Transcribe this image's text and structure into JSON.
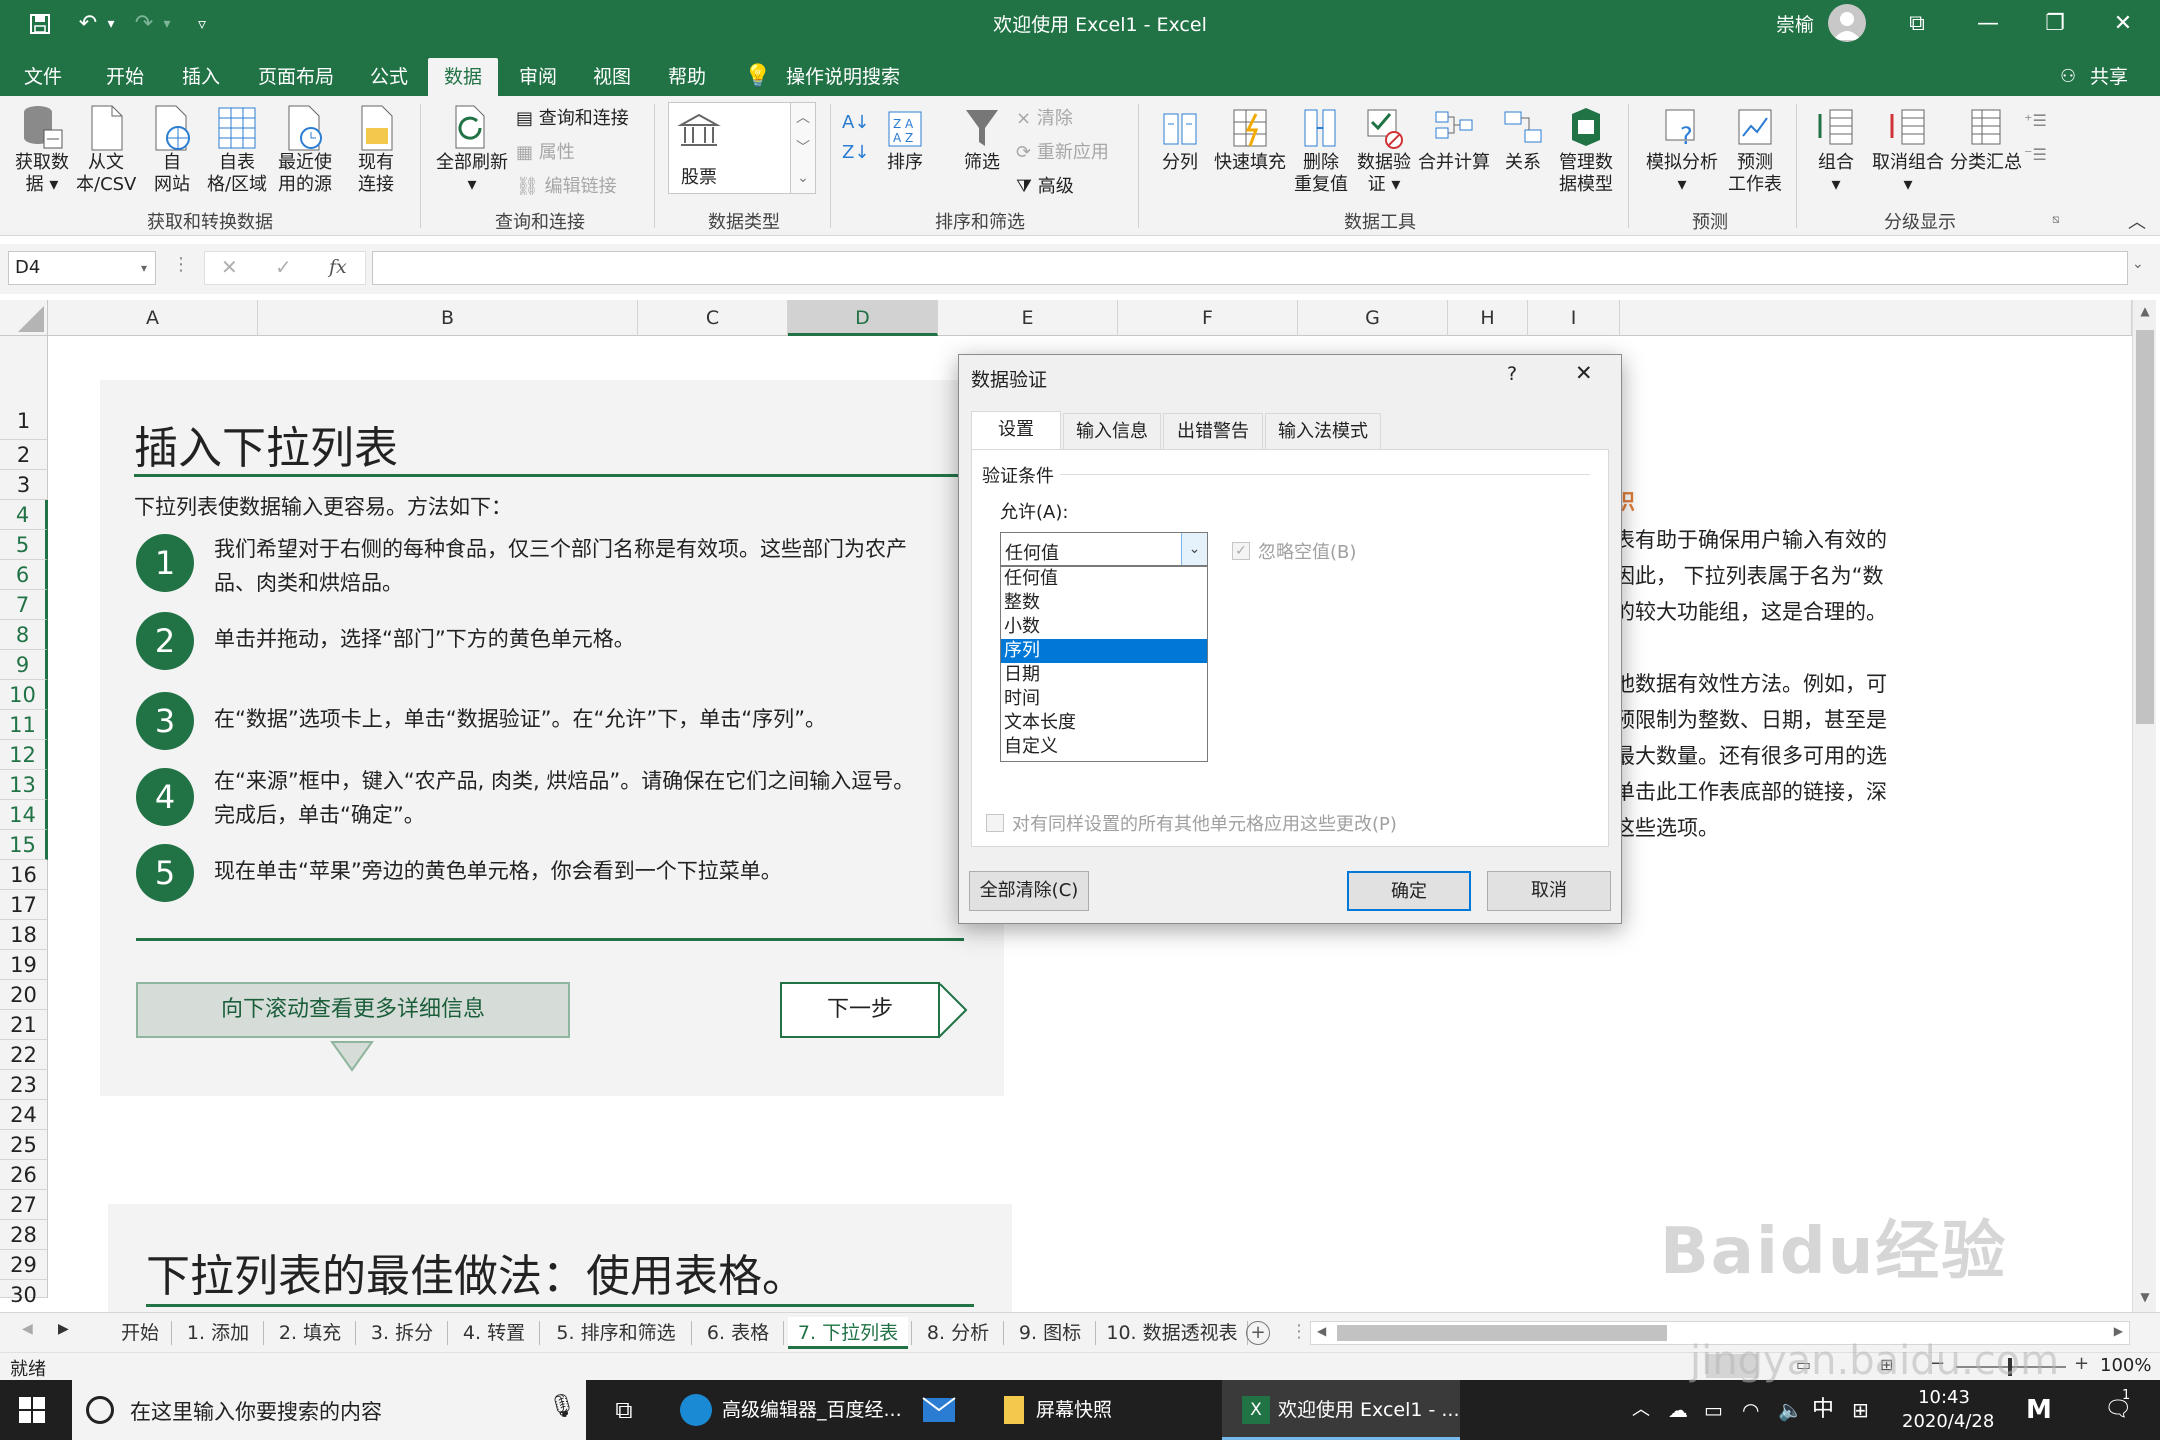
{
  "window": {
    "title": "欢迎使用 Excel1  -  Excel",
    "user": "崇榆"
  },
  "menu": {
    "items": [
      "文件",
      "开始",
      "插入",
      "页面布局",
      "公式",
      "数据",
      "审阅",
      "视图",
      "帮助"
    ],
    "search": "操作说明搜索",
    "share": "共享"
  },
  "ribbon": {
    "get_data": {
      "btn1": "获取数",
      "btn1b": "据",
      "btn2": "从文",
      "btn2b": "本/CSV",
      "btn3": "自",
      "btn3b": "网站",
      "btn4": "自表",
      "btn4b": "格/区域",
      "btn5": "最近使",
      "btn5b": "用的源",
      "btn6": "现有",
      "btn6b": "连接",
      "label": "获取和转换数据"
    },
    "query": {
      "refresh": "全部刷新",
      "qc": "查询和连接",
      "props": "属性",
      "links": "编辑链接",
      "label": "查询和连接"
    },
    "types": {
      "stock": "股票",
      "label": "数据类型"
    },
    "sort": {
      "sort": "排序",
      "filter": "筛选",
      "clear": "清除",
      "reapply": "重新应用",
      "advanced": "高级",
      "label": "排序和筛选"
    },
    "tools": {
      "split": "分列",
      "flash": "快速填充",
      "dedupe": "删除",
      "dedupe2": "重复值",
      "validate": "数据验",
      "validate2": "证",
      "consolidate": "合并计算",
      "relations": "关系",
      "model": "管理数",
      "model2": "据模型",
      "label": "数据工具"
    },
    "forecast": {
      "whatif": "模拟分析",
      "sheet": "预测",
      "sheet2": "工作表",
      "label": "预测"
    },
    "outline": {
      "group": "组合",
      "ungroup": "取消组合",
      "subtotal": "分类汇总",
      "label": "分级显示"
    }
  },
  "formula": {
    "namebox": "D4",
    "fx": "fx"
  },
  "columns": [
    "A",
    "B",
    "C",
    "D",
    "E",
    "F",
    "G",
    "H",
    "I"
  ],
  "rows": [
    "1",
    "2",
    "3",
    "4",
    "5",
    "6",
    "7",
    "8",
    "9",
    "10",
    "11",
    "12",
    "13",
    "14",
    "15",
    "16",
    "17",
    "18",
    "19",
    "20",
    "21",
    "22",
    "23",
    "24",
    "25",
    "26",
    "27",
    "28",
    "29",
    "30"
  ],
  "card1": {
    "title": "插入下拉列表",
    "intro": "下拉列表使数据输入更容易。方法如下：",
    "steps": [
      {
        "n": "1",
        "l1": "我们希望对于右侧的每种食品，仅三个部门名称是有效项。这些部门为农产",
        "l2": "品、肉类和烘焙品。"
      },
      {
        "n": "2",
        "l1": "单击并拖动，选择“部门”下方的黄色单元格。",
        "l2": ""
      },
      {
        "n": "3",
        "l1": "在“数据”选项卡上，单击“数据验证”。在“允许”下，单击“序列”。",
        "l2": ""
      },
      {
        "n": "4",
        "l1": "在“来源”框中，键入“农产品, 肉类, 烘焙品”。请确保在它们之间输入逗号。",
        "l2": "完成后，单击“确定”。"
      },
      {
        "n": "5",
        "l1": "现在单击“苹果”旁边的黄色单元格，你会看到一个下拉菜单。",
        "l2": ""
      }
    ],
    "scroll_btn": "向下滚动查看更多详细信息",
    "next_btn": "下一步"
  },
  "card2": {
    "title": "下拉列表的最佳做法：使用表格。"
  },
  "right_text": {
    "heading": "识",
    "lines": [
      "表有助于确保用户输入有效的",
      "因此， 下拉列表属于名为“数",
      "的较大功能组，这是合理的。",
      "",
      "他数据有效性方法。例如，可",
      "预限制为整数、日期，甚至是",
      "最大数量。还有很多可用的选",
      "单击此工作表底部的链接，深",
      "这些选项。"
    ]
  },
  "dialog": {
    "title": "数据验证",
    "help": "?",
    "close": "✕",
    "tabs": [
      "设置",
      "输入信息",
      "出错警告",
      "输入法模式"
    ],
    "section": "验证条件",
    "allow_label": "允许(A):",
    "allow_value": "任何值",
    "ignore_blank": "忽略空值(B)",
    "options": [
      "任何值",
      "整数",
      "小数",
      "序列",
      "日期",
      "时间",
      "文本长度",
      "自定义"
    ],
    "selected_option": "序列",
    "apply_all": "对有同样设置的所有其他单元格应用这些更改(P)",
    "clear_all": "全部清除(C)",
    "ok": "确定",
    "cancel": "取消"
  },
  "sheets": [
    "开始",
    "1. 添加",
    "2. 填充",
    "3. 拆分",
    "4. 转置",
    "5. 排序和筛选",
    "6. 表格",
    "7. 下拉列表",
    "8. 分析",
    "9. 图标",
    "10. 数据透视表 ..."
  ],
  "active_sheet": "7. 下拉列表",
  "status": {
    "ready": "就绪",
    "zoom": "100%"
  },
  "taskbar": {
    "search": "在这里输入你要搜索的内容",
    "apps": [
      "高级编辑器_百度经...",
      "屏幕快照",
      "欢迎使用 Excel1 - ..."
    ],
    "ime": "中",
    "time": "10:43",
    "date": "2020/4/28",
    "notify": "1"
  },
  "watermark": {
    "brand": "Baidu经验",
    "url": "jingyan.baidu.com"
  },
  "colors": {
    "excel_green": "#217346",
    "dialog_blue": "#0078d7",
    "taskbar": "#1f1f1f"
  }
}
